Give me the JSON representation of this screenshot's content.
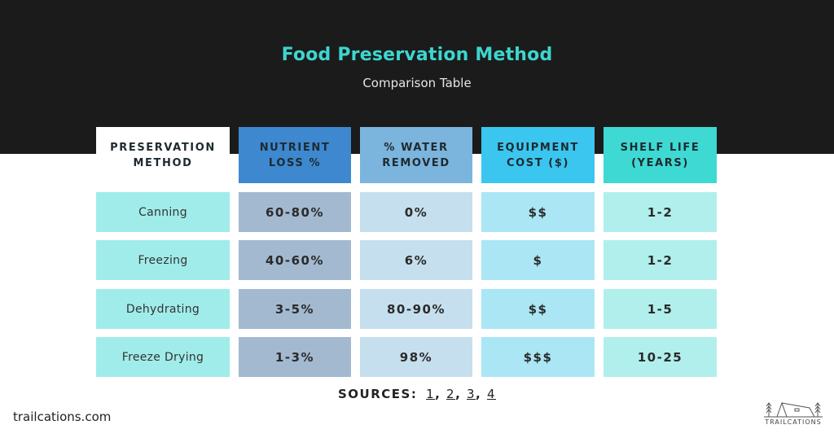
{
  "header": {
    "title": "Food Preservation Method",
    "subtitle": "Comparison Table"
  },
  "colors": {
    "background_dark": "#1b1b1b",
    "title": "#3dd6d0",
    "method_cell": "#a0ecea",
    "header_method": "#ffffff",
    "header_nutrient": "#3d88cf",
    "header_water": "#7bb4dc",
    "header_cost": "#3bc6ef",
    "header_shelf": "#3ed9d3",
    "cell_nutrient": "#a3b9d0",
    "cell_water": "#c6dfee",
    "cell_cost": "#abe6f4",
    "cell_shelf": "#b1efec"
  },
  "table": {
    "columns": [
      {
        "line1": "PRESERVATION",
        "line2": "METHOD"
      },
      {
        "line1": "NUTRIENT",
        "line2": "LOSS %"
      },
      {
        "line1": "% WATER",
        "line2": "REMOVED"
      },
      {
        "line1": "EQUIPMENT",
        "line2": "COST ($)"
      },
      {
        "line1": "SHELF LIFE",
        "line2": "(YEARS)"
      }
    ],
    "rows": [
      {
        "method": "Canning",
        "nutrient_loss": "60-80%",
        "water_removed": "0%",
        "cost": "$$",
        "shelf_life": "1-2"
      },
      {
        "method": "Freezing",
        "nutrient_loss": "40-60%",
        "water_removed": "6%",
        "cost": "$",
        "shelf_life": "1-2"
      },
      {
        "method": "Dehydrating",
        "nutrient_loss": "3-5%",
        "water_removed": "80-90%",
        "cost": "$$",
        "shelf_life": "1-5"
      },
      {
        "method": "Freeze Drying",
        "nutrient_loss": "1-3%",
        "water_removed": "98%",
        "cost": "$$$",
        "shelf_life": "10-25"
      }
    ]
  },
  "sources": {
    "label": "SOURCES:",
    "links": [
      "1",
      "2",
      "3",
      "4"
    ]
  },
  "footer": {
    "site": "trailcations.com",
    "logo_text": "TRAILCATIONS"
  }
}
